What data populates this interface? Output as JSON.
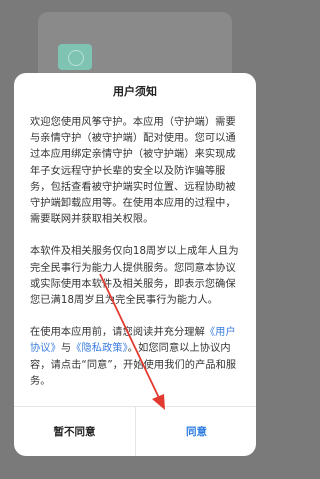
{
  "dialog": {
    "title": "用户须知",
    "para1": "欢迎您使用风筝守护。本应用（守护端）需要与亲情守护（被守护端）配对使用。您可以通过本应用绑定亲情守护（被守护端）来实现成年子女远程守护长辈的安全以及防诈骗等服务，包括查看被守护端实时位置、远程协助被守护端卸载应用等。在使用本应用的过程中，需要联网并获取相关权限。",
    "para2": "本软件及相关服务仅向18周岁以上成年人且为完全民事行为能力人提供服务。您同意本协议或实际使用本软件及相关服务，即表示您确保您已满18周岁且为完全民事行为能力人。",
    "para3_pre": "在使用本应用前，请您阅读并充分理解",
    "user_agreement": "《用户协议》",
    "and": "与",
    "privacy_policy": "《隐私政策》",
    "para3_post": "。如您同意以上协议内容，请点击“同意”，开始使用我们的产品和服务。",
    "disagree_label": "暂不同意",
    "agree_label": "同意"
  },
  "colors": {
    "link": "#3a7de0",
    "agree": "#2f7de1",
    "arrow": "#e23a2e"
  }
}
